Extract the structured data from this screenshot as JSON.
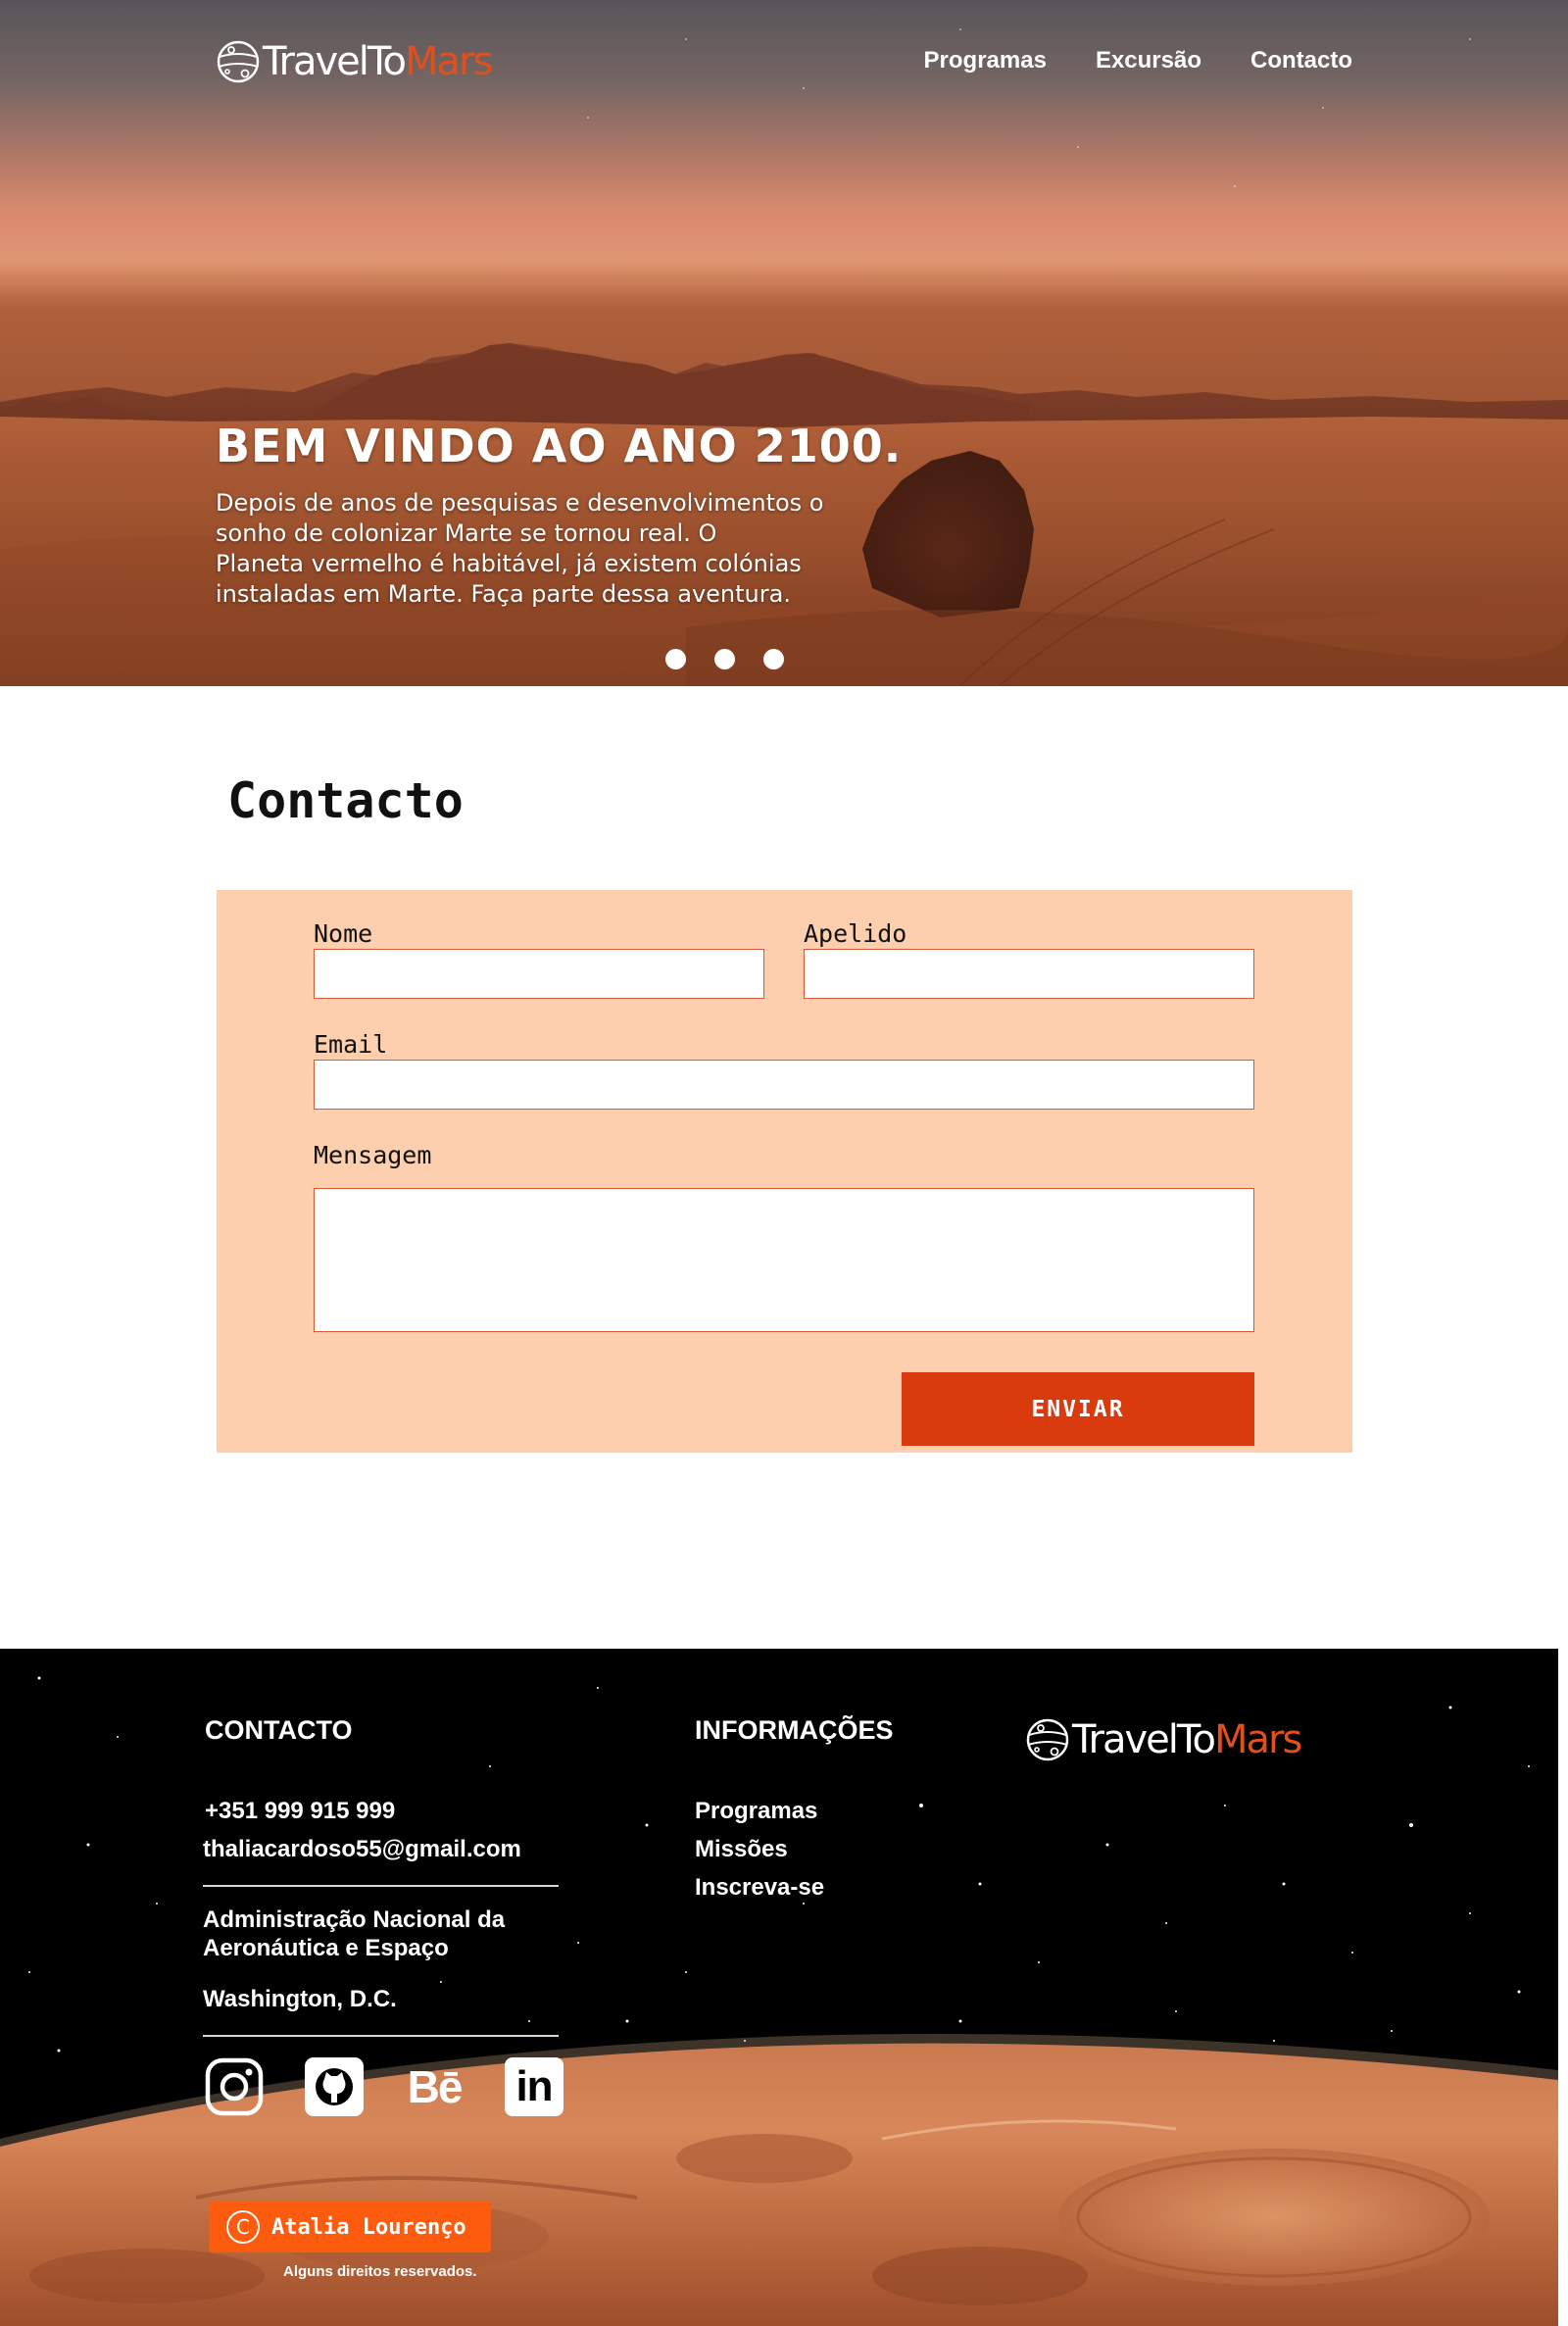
{
  "brand": {
    "name_part1": "TravelTo",
    "name_part2": "Mars",
    "accent_color": "#e0501c"
  },
  "nav": {
    "items": [
      "Programas",
      "Excursão",
      "Contacto"
    ]
  },
  "hero": {
    "title": "BEM VINDO AO ANO 2100.",
    "lines": [
      "Depois de anos de pesquisas e desenvolvimentos o",
      "sonho de colonizar Marte se tornou real. O",
      "Planeta vermelho é habitável, já existem colónias",
      "instaladas em Marte. Faça parte dessa aventura."
    ],
    "slides": 3
  },
  "contact": {
    "title": "Contacto",
    "form": {
      "first_name_label": "Nome",
      "last_name_label": "Apelido",
      "email_label": "Email",
      "message_label": "Mensagem",
      "first_name_value": "",
      "last_name_value": "",
      "email_value": "",
      "message_value": "",
      "submit_label": "ENVIAR"
    },
    "colors": {
      "form_bg": "#fdcfae",
      "button_bg": "#d93b0e",
      "field_border": "#d35a35"
    }
  },
  "footer": {
    "contact_heading": "CONTACTO",
    "phone": "+351 999 915 999",
    "email": "thaliacardoso55@gmail.com",
    "org_line1": "Administração Nacional da",
    "org_line2": "Aeronáutica e Espaço",
    "city": "Washington, D.C.",
    "info_heading": "INFORMAÇÕES",
    "info_links": [
      "Programas",
      "Missões",
      "Inscreva-se"
    ],
    "social_icons": [
      "instagram-icon",
      "github-icon",
      "behance-icon",
      "linkedin-icon"
    ],
    "social_glyphs": {
      "behance": "Bē",
      "linkedin": "in"
    },
    "copyright_symbol": "C",
    "author": "Atalia Lourenço",
    "rights": "Alguns direitos reservados."
  }
}
